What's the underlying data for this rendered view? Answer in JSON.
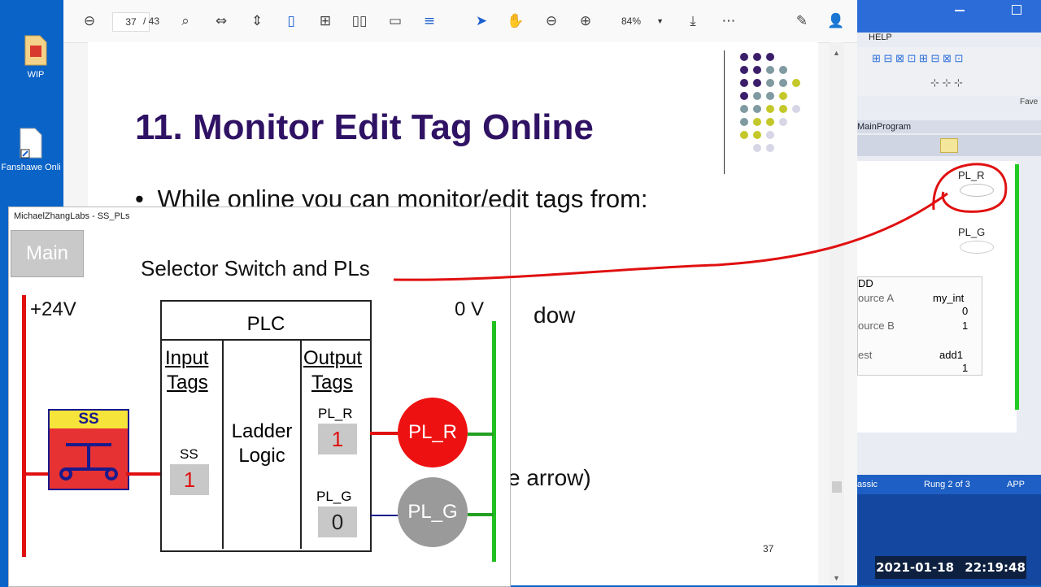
{
  "desktop": {
    "icons": [
      {
        "label": "WIP"
      },
      {
        "label": "Fanshawe Onli"
      }
    ]
  },
  "pdf_viewer": {
    "current_page": "37",
    "page_total": "/ 43",
    "zoom": "84%",
    "slide": {
      "title": "11. Monitor Edit Tag Online",
      "bullet_dot": "•",
      "bullet1": "While online you can monitor/edit tags from:",
      "partial_window_text": "dow",
      "partial_arrow_text": "e arrow)",
      "page_number": "37"
    }
  },
  "hmi_window": {
    "title": "MichaelZhangLabs - SS_PLs",
    "main_button": "Main",
    "heading": "Selector Switch and PLs",
    "plus24": "+24V",
    "zero_v": "0 V",
    "selector_label": "SS",
    "plc_title": "PLC",
    "input_tags_1": "Input",
    "input_tags_2": "Tags",
    "ladder_1": "Ladder",
    "ladder_2": "Logic",
    "output_tags_1": "Output",
    "output_tags_2": "Tags",
    "ss_tag_name": "SS",
    "ss_tag_value": "1",
    "plr_tag_name": "PL_R",
    "plr_tag_value": "1",
    "plg_tag_name": "PL_G",
    "plg_tag_value": "0",
    "lamp_red": "PL_R",
    "lamp_gray": "PL_G",
    "colors": {
      "red_lamp": "#ee1111",
      "gray_lamp": "#9a9a9a",
      "rail_red": "#e01010",
      "rail_green": "#22c022",
      "tag_bg": "#c8c8c8"
    }
  },
  "studio": {
    "menu_help": "HELP",
    "routine": "MainProgram",
    "coil1": "PL_R",
    "coil2": "PL_G",
    "add_title": "DD",
    "source_a_label": "ource A",
    "source_a_tag": "my_int",
    "source_a_value": "0",
    "source_b_label": "ource B",
    "source_b_value": "1",
    "dest_label": "est",
    "dest_tag": "add1",
    "dest_value": "1",
    "status_mode": "assic",
    "status_rung": "Rung 2 of 3",
    "status_app": "APP",
    "favorites": "Fave"
  },
  "taskbar": {
    "date": "2021-01-18",
    "time": "22:19:48"
  }
}
